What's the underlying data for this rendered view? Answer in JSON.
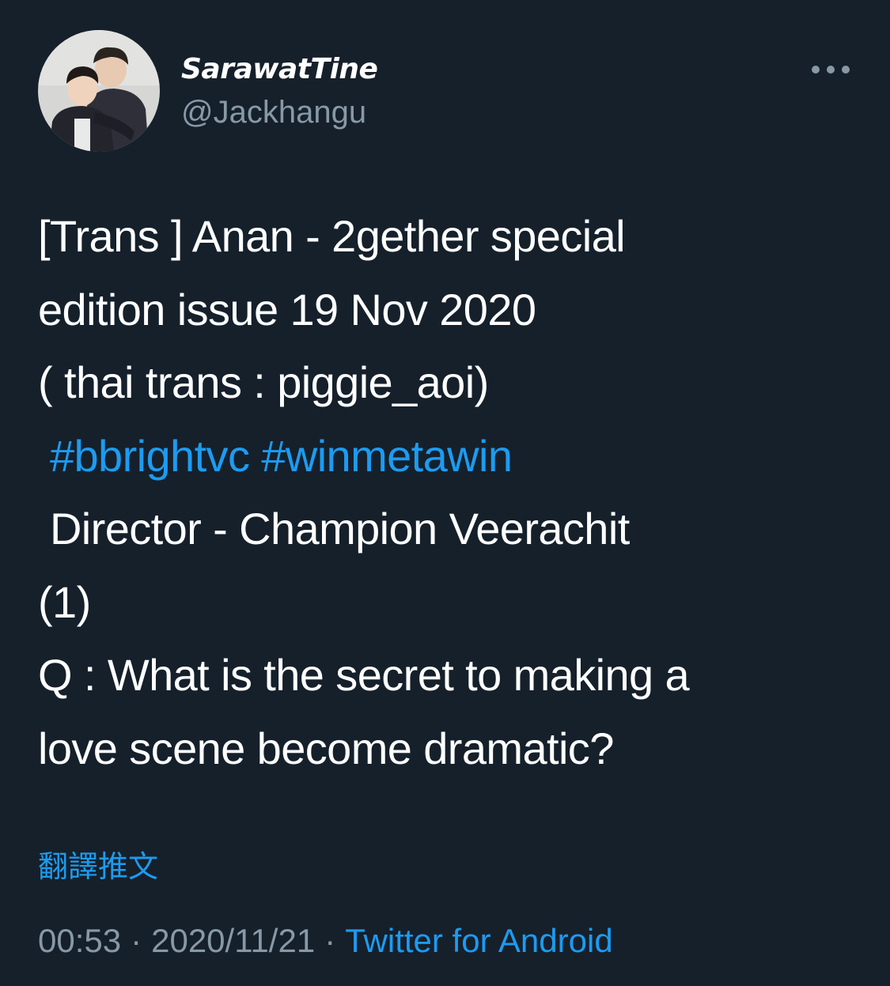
{
  "user": {
    "display_name": "SarawatTine",
    "handle": "@Jackhangu",
    "avatar_icon": "profile-photo"
  },
  "more_icon": "more-horizontal-icon",
  "tweet": {
    "lines": [
      {
        "text": "[Trans ] Anan - 2gether special"
      },
      {
        "text": "edition issue 19 Nov 2020"
      },
      {
        "text": "( thai trans : piggie_aoi)"
      },
      {
        "hashtags": [
          "#bbrightvc",
          "#winmetawin"
        ]
      },
      {
        "text": " Director - Champion Veerachit"
      },
      {
        "text": "(1)"
      },
      {
        "text": "Q : What is the secret to making a"
      },
      {
        "text": "love scene become dramatic?"
      }
    ]
  },
  "translate_label": "翻譯推文",
  "meta": {
    "time": "00:53",
    "separator": "·",
    "date": "2020/11/21",
    "source": "Twitter for Android"
  },
  "colors": {
    "background": "#15202b",
    "text": "#ffffff",
    "secondary": "#8899a6",
    "link": "#1d9bf0"
  }
}
